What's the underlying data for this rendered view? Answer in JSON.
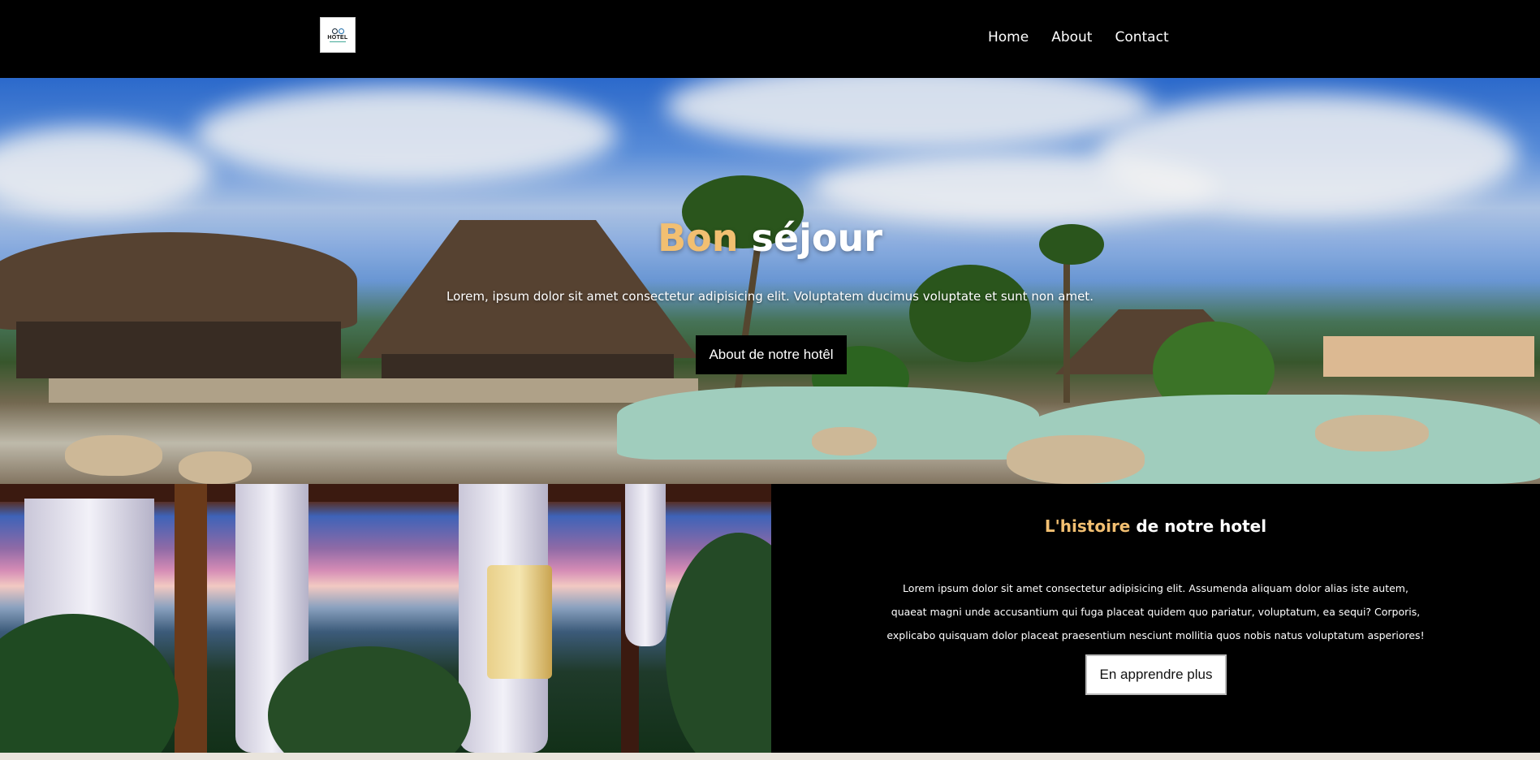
{
  "header": {
    "logo_text": "HOTEL",
    "nav": [
      {
        "label": "Home"
      },
      {
        "label": "About"
      },
      {
        "label": "Contact"
      }
    ]
  },
  "hero": {
    "title_accent": "Bon",
    "title_rest": "séjour",
    "text": "Lorem, ipsum dolor sit amet consectetur adipisicing elit. Voluptatem ducimus voluptate et sunt non amet.",
    "button_label": "About de notre hotêl"
  },
  "story": {
    "title_accent": "L'histoire",
    "title_rest": "de notre hotel",
    "text": "Lorem ipsum dolor sit amet consectetur adipisicing elit. Assumenda aliquam dolor alias iste autem, quaeat magni unde accusantium qui fuga placeat quidem quo pariatur, voluptatum, ea sequi? Corporis, explicabo quisquam dolor placeat praesentium nesciunt mollitia quos nobis natus voluptatum asperiores!",
    "button_label": "En apprendre plus"
  },
  "colors": {
    "accent": "#f2bf71",
    "background": "#000000"
  }
}
